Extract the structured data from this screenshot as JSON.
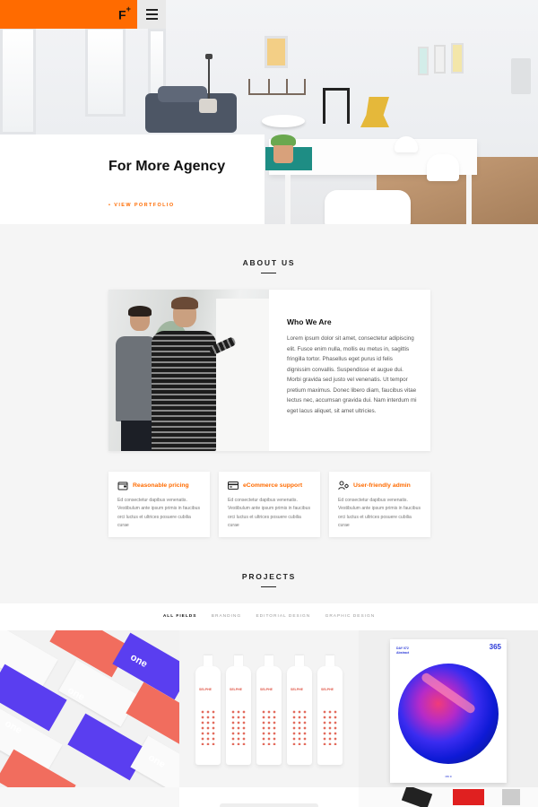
{
  "header": {
    "logo": "F",
    "logo_mark": "+",
    "menu_icon": "hamburger-icon",
    "brand_color": "#ff6b00"
  },
  "hero": {
    "title": "For More Agency",
    "link": "• VIEW PORTFOLIO"
  },
  "about": {
    "section_title": "ABOUT US",
    "heading": "Who We Are",
    "body": "Lorem ipsum dolor sit amet, consectetur adipiscing elit. Fusce enim nulla, mollis eu metus in, sagittis fringilla tortor. Phasellus eget purus id felis dignissim convallis. Suspendisse et augue dui. Morbi gravida sed justo vel venenatis. Ut tempor pretium maximus. Donec libero diam, faucibus vitae lectus nec, accumsan gravida dui. Nam interdum mi eget lacus aliquet, sit amet ultricies."
  },
  "features": [
    {
      "icon": "wallet-icon",
      "title": "Reasonable pricing",
      "body": "Ed consectetur dapibus venenatis. Vestibulum ante ipsum primis in faucibus orci luctus et ultrices posuere cubilia curae"
    },
    {
      "icon": "credit-card-icon",
      "title": "eCommerce support",
      "body": "Ed consectetur dapibus venenatis. Vestibulum ante ipsum primis in faucibus orci luctus et ultrices posuere cubilia curae"
    },
    {
      "icon": "user-settings-icon",
      "title": "User-friendly admin",
      "body": "Ed consectetur dapibus venenatis. Vestibulum ante ipsum primis in faucibus orci luctus et ultrices posuere cubilia curae"
    }
  ],
  "projects": {
    "section_title": "PROJECTS",
    "filters": [
      "ALL FIELDS",
      "BRANDING",
      "EDITORIAL DESIGN",
      "GRAPHIC DESIGN"
    ],
    "active_filter": "ALL FIELDS",
    "tile1_word": "one",
    "bottle_label": "SELPHE",
    "poster_number": "365",
    "poster_subtitle": "DAY 072",
    "poster_subtitle2": "Abstract",
    "poster_footer": "365 D"
  }
}
